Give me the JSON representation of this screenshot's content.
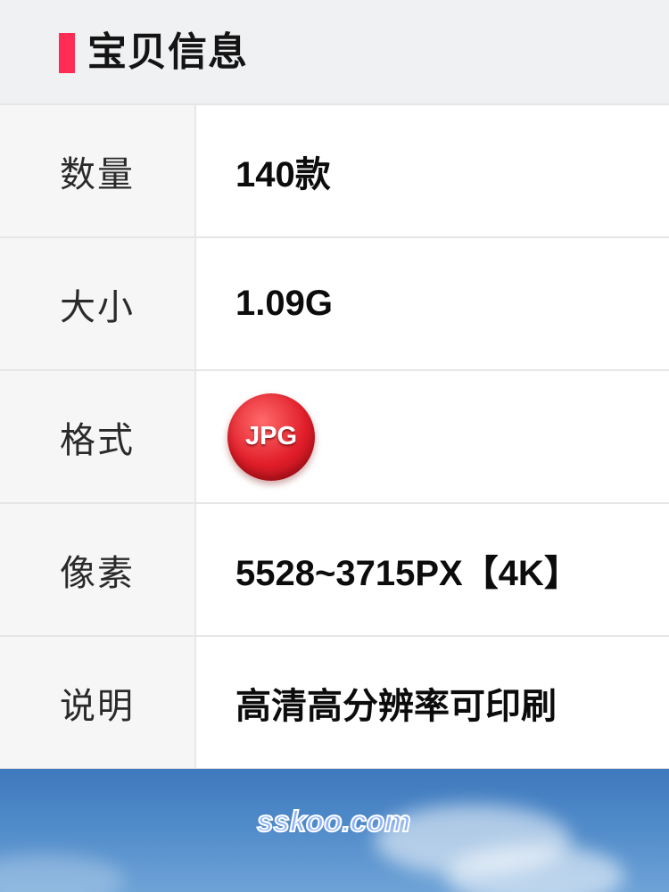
{
  "header": {
    "title": "宝贝信息",
    "accent_color": "#ff2d55"
  },
  "table": {
    "rows": [
      {
        "label": "数量",
        "value": "140款"
      },
      {
        "label": "大小",
        "value": "1.09G"
      },
      {
        "label": "格式",
        "badge": "JPG"
      },
      {
        "label": "像素",
        "value": "5528~3715PX【4K】"
      },
      {
        "label": "说明",
        "value": "高清高分辨率可印刷"
      }
    ]
  },
  "banner": {
    "watermark": "sskoo.com"
  }
}
